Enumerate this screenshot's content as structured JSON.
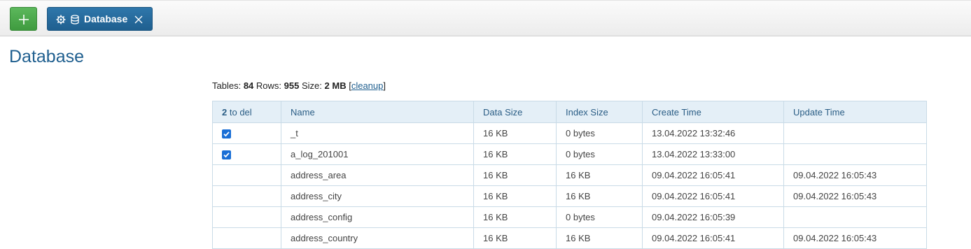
{
  "toolbar": {
    "tab_label": "Database"
  },
  "page": {
    "title": "Database"
  },
  "summary": {
    "tables_label": "Tables:",
    "tables_count": "84",
    "rows_label": "Rows:",
    "rows_count": "955",
    "size_label": "Size:",
    "size_value": "2 MB",
    "cleanup_label": "cleanup"
  },
  "table": {
    "header": {
      "del_count": "2",
      "del_label": "to del",
      "columns": [
        "Name",
        "Data Size",
        "Index Size",
        "Create Time",
        "Update Time"
      ]
    },
    "rows": [
      {
        "checked": true,
        "name": "_t",
        "data_size": "16 KB",
        "index_size": "0 bytes",
        "create_time": "13.04.2022 13:32:46",
        "update_time": ""
      },
      {
        "checked": true,
        "name": "a_log_201001",
        "data_size": "16 KB",
        "index_size": "0 bytes",
        "create_time": "13.04.2022 13:33:00",
        "update_time": ""
      },
      {
        "checked": false,
        "name": "address_area",
        "data_size": "16 KB",
        "index_size": "16 KB",
        "create_time": "09.04.2022 16:05:41",
        "update_time": "09.04.2022 16:05:43"
      },
      {
        "checked": false,
        "name": "address_city",
        "data_size": "16 KB",
        "index_size": "16 KB",
        "create_time": "09.04.2022 16:05:41",
        "update_time": "09.04.2022 16:05:43"
      },
      {
        "checked": false,
        "name": "address_config",
        "data_size": "16 KB",
        "index_size": "0 bytes",
        "create_time": "09.04.2022 16:05:39",
        "update_time": ""
      },
      {
        "checked": false,
        "name": "address_country",
        "data_size": "16 KB",
        "index_size": "16 KB",
        "create_time": "09.04.2022 16:05:41",
        "update_time": "09.04.2022 16:05:43"
      }
    ]
  },
  "colors": {
    "add_button": "#4cae4c",
    "tab_background": "#2a6fa3",
    "title": "#1f5f8f",
    "header_background": "#e4eff7",
    "checkbox": "#1a6fd6"
  },
  "icons": {
    "add": "plus-icon",
    "tab": [
      "gear-icon",
      "database-icon",
      "close-icon"
    ],
    "row_select": "checkbox-checked-icon"
  }
}
